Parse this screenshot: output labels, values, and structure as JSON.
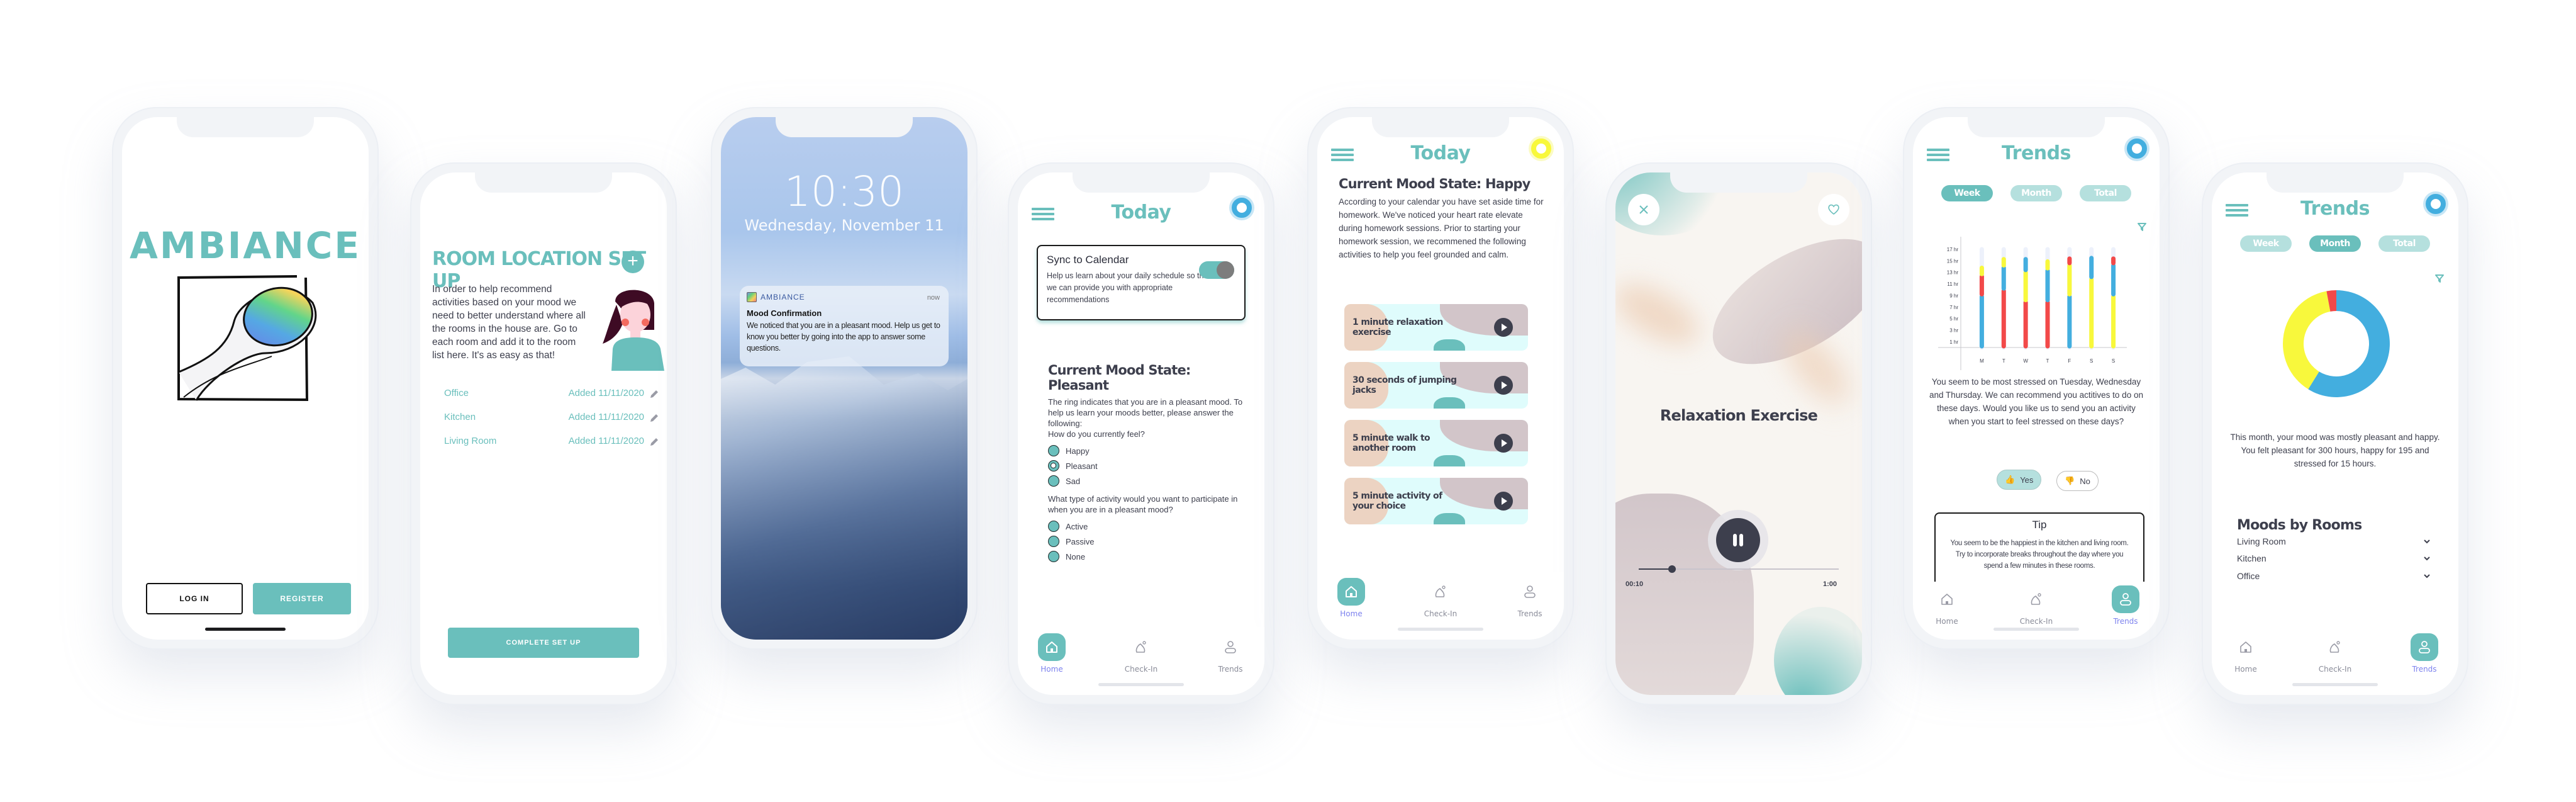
{
  "app_name": "AMBIANCE",
  "colors": {
    "primary_teal": "#6abfbc",
    "teal_light": "#b5e0de",
    "text_dark": "#3d3f4d",
    "nav_active_label": "#7d82ee",
    "mood_pleasant_blue": "#43aedf",
    "mood_happy_yellow": "#f8f83c",
    "mood_stressed_red": "#f24949"
  },
  "bottom_nav": {
    "items": [
      {
        "label": "Home",
        "icon": "home-icon"
      },
      {
        "label": "Check-In",
        "icon": "check-in-icon"
      },
      {
        "label": "Trends",
        "icon": "person-icon"
      }
    ]
  },
  "welcome": {
    "logo_text": "AMBIANCE",
    "login_label": "LOG IN",
    "register_label": "REGISTER"
  },
  "room_setup": {
    "title": "ROOM LOCATION SET UP",
    "add_icon": "plus-icon",
    "description": "In order to help recommend activities based on your mood we need to better understand where all the rooms in the house are. Go to each room and add it to the room list here. It's as easy as that!",
    "rooms": [
      {
        "name": "Office",
        "added": "Added 11/11/2020"
      },
      {
        "name": "Kitchen",
        "added": "Added 11/11/2020"
      },
      {
        "name": "Living Room",
        "added": "Added 11/11/2020"
      }
    ],
    "complete_label": "COMPLETE SET UP"
  },
  "lock_screen": {
    "time": "10:30",
    "date": "Wednesday, November 11",
    "notification": {
      "app": "AMBIANCE",
      "time": "now",
      "title": "Mood Confirmation",
      "body": "We noticed that you are in a pleasant mood. Help us get to know you better by going into the app to answer some questions."
    }
  },
  "today_pleasant": {
    "title": "Today",
    "mood_ring_color": "#43aedf",
    "sync": {
      "title": "Sync to Calendar",
      "description": "Help us learn about your daily schedule so that we can provide you with appropriate recommendations",
      "enabled": true
    },
    "mood_heading": "Current Mood State: Pleasant",
    "intro": "The ring indicates that you are in a pleasant mood. To help us learn your moods better, please answer the following:",
    "question1": "How do you currently feel?",
    "feel_options": [
      {
        "label": "Happy",
        "selected": false
      },
      {
        "label": "Pleasant",
        "selected": true
      },
      {
        "label": "Sad",
        "selected": false
      }
    ],
    "question2": "What type of activity would you want to participate in when you are in a pleasant mood?",
    "activity_options": [
      {
        "label": "Active",
        "selected": false
      },
      {
        "label": "Passive",
        "selected": false
      },
      {
        "label": "None",
        "selected": false
      }
    ],
    "active_nav": "Home"
  },
  "today_happy": {
    "title": "Today",
    "mood_ring_color": "#f8f83c",
    "mood_heading": "Current Mood State: Happy",
    "description": "According to your calendar you have set aside time for homework. We've noticed your heart rate elevate during homework sessions. Prior to starting your homework session, we recommened the following activities to help you feel grounded and calm.",
    "activities": [
      "1 minute relaxation exercise",
      "30 seconds of jumping jacks",
      "5 minute walk to another room",
      "5 minute activity of your choice"
    ],
    "active_nav": "Home"
  },
  "relaxation": {
    "title": "Relaxation Exercise",
    "elapsed": "00:10",
    "duration": "1:00",
    "progress": 0.1667,
    "state": "playing"
  },
  "trends_week": {
    "title": "Trends",
    "segments": [
      "Week",
      "Month",
      "Total"
    ],
    "active_segment": "Week",
    "message": "You seem to be most stressed on Tuesday, Wednesday and Thursday. We can recommend you actitives to do on these days. Would you like us to send you an activity when you start to feel stressed on these days?",
    "yes_label": "Yes",
    "no_label": "No",
    "tip": {
      "title": "Tip",
      "body": "You seem to be the happiest in the kitchen and living room. Try to incorporate breaks throughout the day where you spend a few minutes in these rooms."
    },
    "active_nav": "Trends"
  },
  "trends_month": {
    "title": "Trends",
    "segments": [
      "Week",
      "Month",
      "Total"
    ],
    "active_segment": "Month",
    "summary": "This month, your mood was mostly pleasant and happy. You felt pleasant for 300 hours, happy for 195 and stressed for 15 hours.",
    "rooms_heading": "Moods by Rooms",
    "rooms": [
      "Living Room",
      "Kitchen",
      "Office"
    ],
    "active_nav": "Trends"
  },
  "chart_data": [
    {
      "type": "bar",
      "stacked": true,
      "title": "",
      "xlabel": "",
      "ylabel": "hours",
      "categories": [
        "M",
        "T",
        "W",
        "T",
        "F",
        "S",
        "S"
      ],
      "y_ticks": [
        "1 hr",
        "3 hr",
        "5 hr",
        "7 hr",
        "9 hr",
        "11 hr",
        "13 hr",
        "15 hr",
        "17 hr"
      ],
      "ylim": [
        0,
        17
      ],
      "segments_bottom_to_top": [
        [
          {
            "mood": "pleasant",
            "value": 9
          },
          {
            "mood": "stressed",
            "value": 3.5
          },
          {
            "mood": "happy",
            "value": 1.5
          }
        ],
        [
          {
            "mood": "stressed",
            "value": 10
          },
          {
            "mood": "pleasant",
            "value": 4
          },
          {
            "mood": "happy",
            "value": 1.5
          }
        ],
        [
          {
            "mood": "stressed",
            "value": 8
          },
          {
            "mood": "happy",
            "value": 5.2
          },
          {
            "mood": "pleasant",
            "value": 2.3
          }
        ],
        [
          {
            "mood": "stressed",
            "value": 8
          },
          {
            "mood": "pleasant",
            "value": 5.5
          },
          {
            "mood": "happy",
            "value": 1.6
          }
        ],
        [
          {
            "mood": "pleasant",
            "value": 9
          },
          {
            "mood": "happy",
            "value": 5.4
          },
          {
            "mood": "stressed",
            "value": 1.2
          }
        ],
        [
          {
            "mood": "happy",
            "value": 12
          },
          {
            "mood": "pleasant",
            "value": 3.7
          }
        ],
        [
          {
            "mood": "happy",
            "value": 9
          },
          {
            "mood": "pleasant",
            "value": 5.4
          },
          {
            "mood": "stressed",
            "value": 1.2
          }
        ]
      ],
      "legend": {
        "pleasant": "#43aedf",
        "happy": "#f8f83c",
        "stressed": "#f24949"
      },
      "grid": false
    },
    {
      "type": "pie",
      "donut": true,
      "title": "",
      "slices": [
        {
          "label": "Pleasant",
          "value": 300,
          "color": "#43aedf"
        },
        {
          "label": "Happy",
          "value": 195,
          "color": "#f8f83c"
        },
        {
          "label": "Stressed",
          "value": 15,
          "color": "#f24949"
        }
      ]
    }
  ]
}
